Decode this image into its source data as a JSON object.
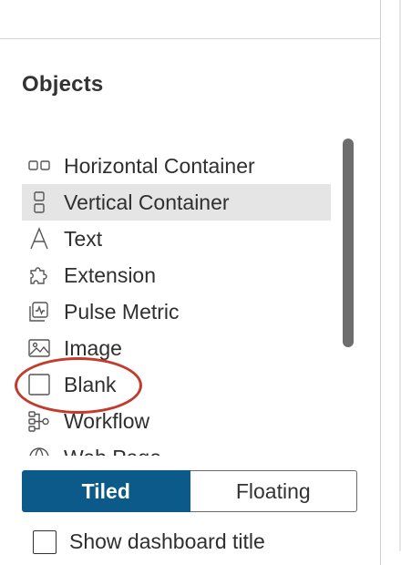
{
  "objects_panel": {
    "title": "Objects",
    "items": [
      {
        "label": "Horizontal Container",
        "icon": "horizontal-container-icon",
        "selected": false
      },
      {
        "label": "Vertical Container",
        "icon": "vertical-container-icon",
        "selected": true
      },
      {
        "label": "Text",
        "icon": "text-icon",
        "selected": false
      },
      {
        "label": "Extension",
        "icon": "extension-icon",
        "selected": false
      },
      {
        "label": "Pulse Metric",
        "icon": "pulse-metric-icon",
        "selected": false
      },
      {
        "label": "Image",
        "icon": "image-icon",
        "selected": false
      },
      {
        "label": "Blank",
        "icon": "blank-icon",
        "selected": false,
        "annotated": true
      },
      {
        "label": "Workflow",
        "icon": "workflow-icon",
        "selected": false
      },
      {
        "label": "Web Page",
        "icon": "web-page-icon",
        "selected": false
      }
    ]
  },
  "layout_toggle": {
    "options": [
      "Tiled",
      "Floating"
    ],
    "selected": "Tiled"
  },
  "dashboard_title": {
    "label": "Show dashboard title",
    "checked": false
  },
  "colors": {
    "accent": "#0b5a8a",
    "selected_row": "#e5e5e5",
    "annotation": "#c23b2c"
  }
}
